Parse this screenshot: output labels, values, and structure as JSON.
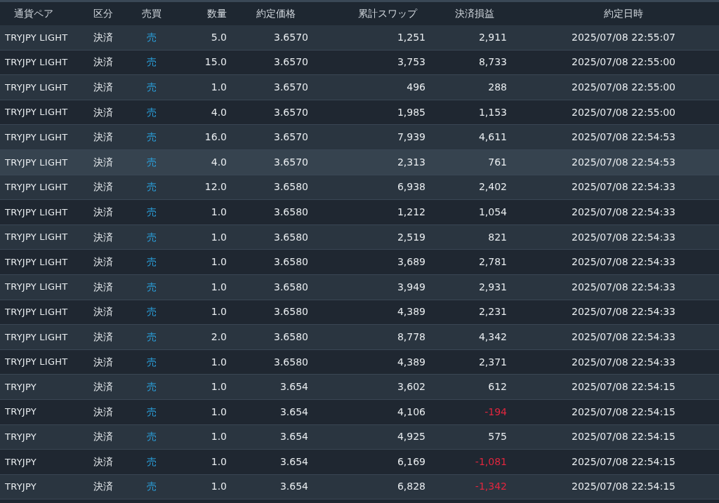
{
  "columns": [
    "通貨ペア",
    "区分",
    "売買",
    "数量",
    "約定価格",
    "累計スワップ",
    "決済損益",
    "約定日時"
  ],
  "rows": [
    {
      "pair": "TRYJPY LIGHT",
      "type": "決済",
      "side": "売",
      "qty": "5.0",
      "price": "3.6570",
      "swap": "1,251",
      "pnl": "2,911",
      "negative": false,
      "time": "2025/07/08 22:55:07",
      "selected": false
    },
    {
      "pair": "TRYJPY LIGHT",
      "type": "決済",
      "side": "売",
      "qty": "15.0",
      "price": "3.6570",
      "swap": "3,753",
      "pnl": "8,733",
      "negative": false,
      "time": "2025/07/08 22:55:00",
      "selected": false
    },
    {
      "pair": "TRYJPY LIGHT",
      "type": "決済",
      "side": "売",
      "qty": "1.0",
      "price": "3.6570",
      "swap": "496",
      "pnl": "288",
      "negative": false,
      "time": "2025/07/08 22:55:00",
      "selected": false
    },
    {
      "pair": "TRYJPY LIGHT",
      "type": "決済",
      "side": "売",
      "qty": "4.0",
      "price": "3.6570",
      "swap": "1,985",
      "pnl": "1,153",
      "negative": false,
      "time": "2025/07/08 22:55:00",
      "selected": false
    },
    {
      "pair": "TRYJPY LIGHT",
      "type": "決済",
      "side": "売",
      "qty": "16.0",
      "price": "3.6570",
      "swap": "7,939",
      "pnl": "4,611",
      "negative": false,
      "time": "2025/07/08 22:54:53",
      "selected": false
    },
    {
      "pair": "TRYJPY LIGHT",
      "type": "決済",
      "side": "売",
      "qty": "4.0",
      "price": "3.6570",
      "swap": "2,313",
      "pnl": "761",
      "negative": false,
      "time": "2025/07/08 22:54:53",
      "selected": true
    },
    {
      "pair": "TRYJPY LIGHT",
      "type": "決済",
      "side": "売",
      "qty": "12.0",
      "price": "3.6580",
      "swap": "6,938",
      "pnl": "2,402",
      "negative": false,
      "time": "2025/07/08 22:54:33",
      "selected": false
    },
    {
      "pair": "TRYJPY LIGHT",
      "type": "決済",
      "side": "売",
      "qty": "1.0",
      "price": "3.6580",
      "swap": "1,212",
      "pnl": "1,054",
      "negative": false,
      "time": "2025/07/08 22:54:33",
      "selected": false
    },
    {
      "pair": "TRYJPY LIGHT",
      "type": "決済",
      "side": "売",
      "qty": "1.0",
      "price": "3.6580",
      "swap": "2,519",
      "pnl": "821",
      "negative": false,
      "time": "2025/07/08 22:54:33",
      "selected": false
    },
    {
      "pair": "TRYJPY LIGHT",
      "type": "決済",
      "side": "売",
      "qty": "1.0",
      "price": "3.6580",
      "swap": "3,689",
      "pnl": "2,781",
      "negative": false,
      "time": "2025/07/08 22:54:33",
      "selected": false
    },
    {
      "pair": "TRYJPY LIGHT",
      "type": "決済",
      "side": "売",
      "qty": "1.0",
      "price": "3.6580",
      "swap": "3,949",
      "pnl": "2,931",
      "negative": false,
      "time": "2025/07/08 22:54:33",
      "selected": false
    },
    {
      "pair": "TRYJPY LIGHT",
      "type": "決済",
      "side": "売",
      "qty": "1.0",
      "price": "3.6580",
      "swap": "4,389",
      "pnl": "2,231",
      "negative": false,
      "time": "2025/07/08 22:54:33",
      "selected": false
    },
    {
      "pair": "TRYJPY LIGHT",
      "type": "決済",
      "side": "売",
      "qty": "2.0",
      "price": "3.6580",
      "swap": "8,778",
      "pnl": "4,342",
      "negative": false,
      "time": "2025/07/08 22:54:33",
      "selected": false
    },
    {
      "pair": "TRYJPY LIGHT",
      "type": "決済",
      "side": "売",
      "qty": "1.0",
      "price": "3.6580",
      "swap": "4,389",
      "pnl": "2,371",
      "negative": false,
      "time": "2025/07/08 22:54:33",
      "selected": false
    },
    {
      "pair": "TRYJPY",
      "type": "決済",
      "side": "売",
      "qty": "1.0",
      "price": "3.654",
      "swap": "3,602",
      "pnl": "612",
      "negative": false,
      "time": "2025/07/08 22:54:15",
      "selected": false
    },
    {
      "pair": "TRYJPY",
      "type": "決済",
      "side": "売",
      "qty": "1.0",
      "price": "3.654",
      "swap": "4,106",
      "pnl": "-194",
      "negative": true,
      "time": "2025/07/08 22:54:15",
      "selected": false
    },
    {
      "pair": "TRYJPY",
      "type": "決済",
      "side": "売",
      "qty": "1.0",
      "price": "3.654",
      "swap": "4,925",
      "pnl": "575",
      "negative": false,
      "time": "2025/07/08 22:54:15",
      "selected": false
    },
    {
      "pair": "TRYJPY",
      "type": "決済",
      "side": "売",
      "qty": "1.0",
      "price": "3.654",
      "swap": "6,169",
      "pnl": "-1,081",
      "negative": true,
      "time": "2025/07/08 22:54:15",
      "selected": false
    },
    {
      "pair": "TRYJPY",
      "type": "決済",
      "side": "売",
      "qty": "1.0",
      "price": "3.654",
      "swap": "6,828",
      "pnl": "-1,342",
      "negative": true,
      "time": "2025/07/08 22:54:15",
      "selected": false
    }
  ]
}
